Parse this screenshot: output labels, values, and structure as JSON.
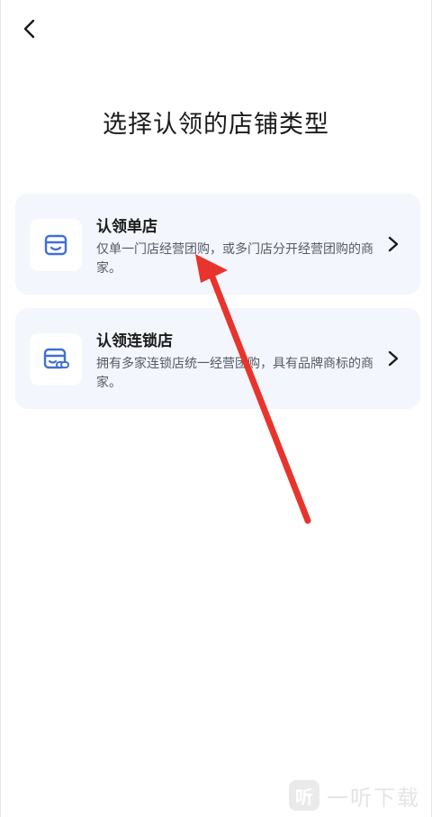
{
  "header": {
    "back_icon": "chevron-left-icon",
    "title": "选择认领的店铺类型"
  },
  "options": [
    {
      "icon": "storefront-icon",
      "title": "认领单店",
      "description": "仅单一门店经营团购，或多门店分开经营团购的商家。",
      "action_icon": "chevron-right-icon"
    },
    {
      "icon": "chain-store-icon",
      "title": "认领连锁店",
      "description": "拥有多家连锁店统一经营团购，具有品牌商标的商家。",
      "action_icon": "chevron-right-icon"
    }
  ],
  "colors": {
    "accent": "#3f6fd8",
    "card_bg": "#f3f6fc",
    "annotation_arrow": "#e8342c"
  },
  "watermark": {
    "logo_text": "听",
    "text": "一听下载"
  }
}
